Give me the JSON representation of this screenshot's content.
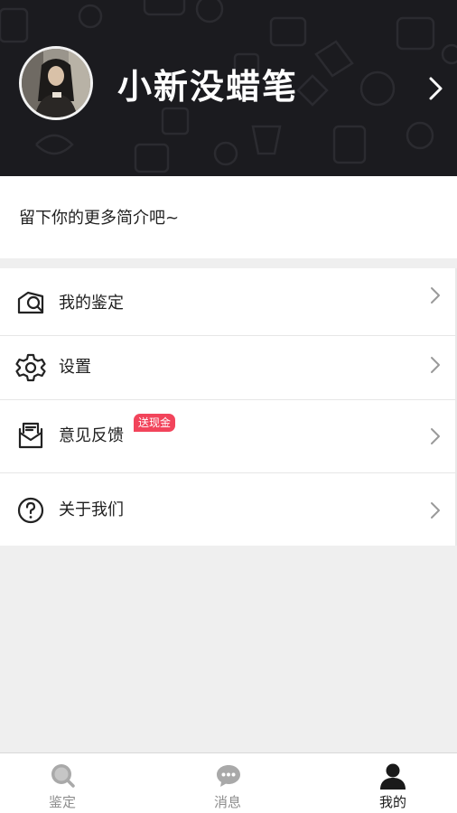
{
  "header": {
    "username": "小新没蜡笔",
    "background_color": "#1b1b1f"
  },
  "profile": {
    "bio_placeholder": "留下你的更多简介吧~"
  },
  "menu": {
    "items": [
      {
        "label": "我的鉴定",
        "icon": "appraisal-icon"
      },
      {
        "label": "设置",
        "icon": "gear-icon"
      },
      {
        "label": "意见反馈",
        "icon": "feedback-mail-icon",
        "badge": "送现金"
      },
      {
        "label": "关于我们",
        "icon": "question-circle-icon"
      }
    ],
    "badge_color": "#f2445b"
  },
  "tabbar": {
    "tabs": [
      {
        "label": "鉴定",
        "icon": "magnifier-icon",
        "active": false
      },
      {
        "label": "消息",
        "icon": "chat-bubble-icon",
        "active": false
      },
      {
        "label": "我的",
        "icon": "user-icon",
        "active": true
      }
    ],
    "inactive_color": "#8d8d8d",
    "active_color": "#1a1a1a"
  }
}
